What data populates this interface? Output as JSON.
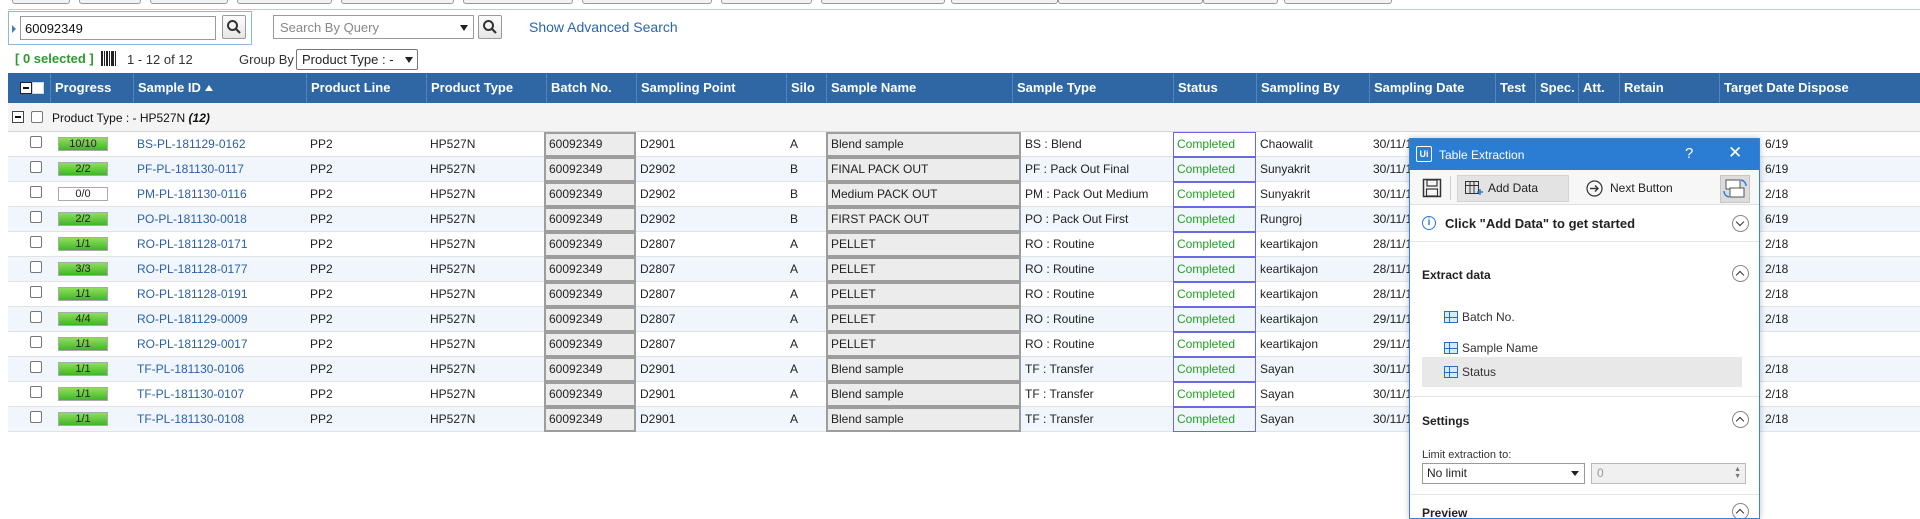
{
  "search": {
    "value": "60092349",
    "query_placeholder": "Search By Query",
    "advanced_link": "Show Advanced Search"
  },
  "toolbar": {
    "selected": "[ 0 selected ]",
    "pager": "1 - 12 of 12",
    "groupby_label": "Group By",
    "groupby_value": "Product Type : -"
  },
  "columns": [
    "Progress",
    "Sample ID",
    "Product Line",
    "Product Type",
    "Batch No.",
    "Sampling Point",
    "Silo",
    "Sample Name",
    "Sample Type",
    "Status",
    "Sampling By",
    "Sampling Date",
    "Test",
    "Spec.",
    "Att.",
    "Retain",
    "Target Date Dispose"
  ],
  "group": {
    "label": "Product Type : - HP527N",
    "count": "(12)"
  },
  "rows": [
    {
      "progress": "10/10",
      "fill": 1.0,
      "id": "BS-PL-181129-0162",
      "line": "PP2",
      "type": "HP527N",
      "batch": "60092349",
      "point": "D2901",
      "silo": "A",
      "name": "Blend sample",
      "stype": "BS : Blend",
      "status": "Completed",
      "by": "Chaowalit",
      "date": "30/11/1",
      "dispose": "6/19"
    },
    {
      "progress": "2/2",
      "fill": 1.0,
      "id": "PF-PL-181130-0117",
      "line": "PP2",
      "type": "HP527N",
      "batch": "60092349",
      "point": "D2902",
      "silo": "B",
      "name": "FINAL PACK OUT",
      "stype": "PF : Pack Out Final",
      "status": "Completed",
      "by": "Sunyakrit",
      "date": "30/11/1",
      "dispose": "6/19"
    },
    {
      "progress": "0/0",
      "fill": 0.0,
      "id": "PM-PL-181130-0116",
      "line": "PP2",
      "type": "HP527N",
      "batch": "60092349",
      "point": "D2902",
      "silo": "B",
      "name": "Medium PACK OUT",
      "stype": "PM : Pack Out Medium",
      "status": "Completed",
      "by": "Sunyakrit",
      "date": "30/11/1",
      "dispose": "2/18"
    },
    {
      "progress": "2/2",
      "fill": 1.0,
      "id": "PO-PL-181130-0018",
      "line": "PP2",
      "type": "HP527N",
      "batch": "60092349",
      "point": "D2902",
      "silo": "B",
      "name": "FIRST PACK OUT",
      "stype": "PO : Pack Out First",
      "status": "Completed",
      "by": "Rungroj",
      "date": "30/11/1",
      "dispose": "6/19"
    },
    {
      "progress": "1/1",
      "fill": 1.0,
      "id": "RO-PL-181128-0171",
      "line": "PP2",
      "type": "HP527N",
      "batch": "60092349",
      "point": "D2807",
      "silo": "A",
      "name": "PELLET",
      "stype": "RO : Routine",
      "status": "Completed",
      "by": "keartikajon",
      "date": "28/11/1",
      "dispose": "2/18"
    },
    {
      "progress": "3/3",
      "fill": 1.0,
      "id": "RO-PL-181128-0177",
      "line": "PP2",
      "type": "HP527N",
      "batch": "60092349",
      "point": "D2807",
      "silo": "A",
      "name": "PELLET",
      "stype": "RO : Routine",
      "status": "Completed",
      "by": "keartikajon",
      "date": "28/11/1",
      "dispose": "2/18"
    },
    {
      "progress": "1/1",
      "fill": 1.0,
      "id": "RO-PL-181128-0191",
      "line": "PP2",
      "type": "HP527N",
      "batch": "60092349",
      "point": "D2807",
      "silo": "A",
      "name": "PELLET",
      "stype": "RO : Routine",
      "status": "Completed",
      "by": "keartikajon",
      "date": "28/11/1",
      "dispose": "2/18"
    },
    {
      "progress": "4/4",
      "fill": 1.0,
      "id": "RO-PL-181129-0009",
      "line": "PP2",
      "type": "HP527N",
      "batch": "60092349",
      "point": "D2807",
      "silo": "A",
      "name": "PELLET",
      "stype": "RO : Routine",
      "status": "Completed",
      "by": "keartikajon",
      "date": "29/11/1",
      "dispose": "2/18"
    },
    {
      "progress": "1/1",
      "fill": 1.0,
      "id": "RO-PL-181129-0017",
      "line": "PP2",
      "type": "HP527N",
      "batch": "60092349",
      "point": "D2807",
      "silo": "A",
      "name": "PELLET",
      "stype": "RO : Routine",
      "status": "Completed",
      "by": "keartikajon",
      "date": "29/11/1",
      "dispose": ""
    },
    {
      "progress": "1/1",
      "fill": 1.0,
      "id": "TF-PL-181130-0106",
      "line": "PP2",
      "type": "HP527N",
      "batch": "60092349",
      "point": "D2901",
      "silo": "A",
      "name": "Blend sample",
      "stype": "TF : Transfer",
      "status": "Completed",
      "by": "Sayan",
      "date": "30/11/1",
      "dispose": "2/18"
    },
    {
      "progress": "1/1",
      "fill": 1.0,
      "id": "TF-PL-181130-0107",
      "line": "PP2",
      "type": "HP527N",
      "batch": "60092349",
      "point": "D2901",
      "silo": "A",
      "name": "Blend sample",
      "stype": "TF : Transfer",
      "status": "Completed",
      "by": "Sayan",
      "date": "30/11/1",
      "dispose": "2/18"
    },
    {
      "progress": "1/1",
      "fill": 1.0,
      "id": "TF-PL-181130-0108",
      "line": "PP2",
      "type": "HP527N",
      "batch": "60092349",
      "point": "D2901",
      "silo": "A",
      "name": "Blend sample",
      "stype": "TF : Transfer",
      "status": "Completed",
      "by": "Sayan",
      "date": "30/11/1",
      "dispose": "2/18"
    }
  ],
  "dialog": {
    "title": "Table Extraction",
    "help": "?",
    "close": "✕",
    "add_data": "Add Data",
    "next_button": "Next Button",
    "info": "Click \"Add Data\" to get started",
    "extract_header": "Extract data",
    "fields": [
      "Batch No.",
      "Sample Name",
      "Status"
    ],
    "settings_header": "Settings",
    "limit_label": "Limit extraction to:",
    "limit_value": "No limit",
    "limit_number": "0",
    "preview_header": "Preview"
  },
  "colors": {
    "header_bg": "#2e67a4",
    "link": "#2a5fa8",
    "status_text": "#23a023",
    "dialog_accent": "#2b7cd3",
    "progress_fill": "#40b52a"
  }
}
